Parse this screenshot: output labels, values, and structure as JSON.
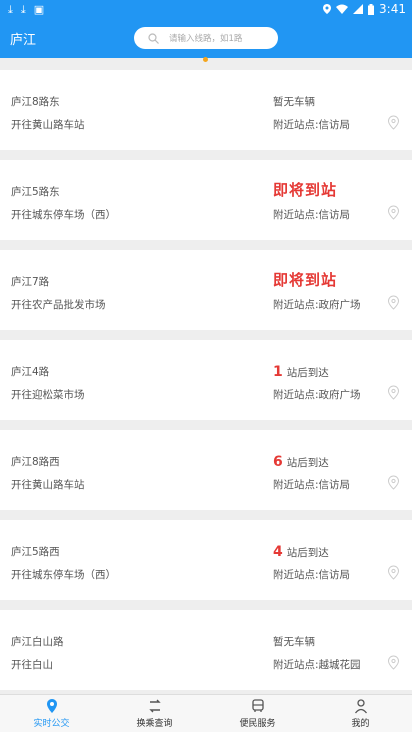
{
  "status_bar": {
    "time": "3:41",
    "left_icons": [
      "download-icon",
      "download-icon",
      "image-icon"
    ],
    "right_icons": [
      "location-icon",
      "wifi-icon",
      "signal-icon",
      "battery-icon"
    ]
  },
  "header": {
    "city": "庐江",
    "search_placeholder": "请输入线路，如1路"
  },
  "colors": {
    "primary": "#2196f3",
    "alert": "#e53935",
    "indicator": "#f4a51c"
  },
  "buses": [
    {
      "route": "庐江8路东",
      "dest": "开往黄山路车站",
      "status_text": "暂无车辆",
      "station": "附近站点:信访局"
    },
    {
      "route": "庐江5路东",
      "dest": "开往城东停车场（西）",
      "status_text": "即将到站",
      "station": "附近站点:信访局"
    },
    {
      "route": "庐江7路",
      "dest": "开往农产品批发市场",
      "status_text": "即将到站",
      "station": "附近站点:政府广场"
    },
    {
      "route": "庐江4路",
      "dest": "开往迎松菜市场",
      "status_num": "1",
      "status_text": "站后到达",
      "station": "附近站点:政府广场"
    },
    {
      "route": "庐江8路西",
      "dest": "开往黄山路车站",
      "status_num": "6",
      "status_text": "站后到达",
      "station": "附近站点:信访局"
    },
    {
      "route": "庐江5路西",
      "dest": "开往城东停车场（西）",
      "status_num": "4",
      "status_text": "站后到达",
      "station": "附近站点:信访局"
    },
    {
      "route": "庐江白山路",
      "dest": "开往白山",
      "status_text": "暂无车辆",
      "station": "附近站点:越城花园"
    }
  ],
  "tabs": [
    {
      "label": "实时公交",
      "icon": "location-icon"
    },
    {
      "label": "换乘查询",
      "icon": "transfer-icon"
    },
    {
      "label": "便民服务",
      "icon": "bus-icon"
    },
    {
      "label": "我的",
      "icon": "person-icon"
    }
  ]
}
